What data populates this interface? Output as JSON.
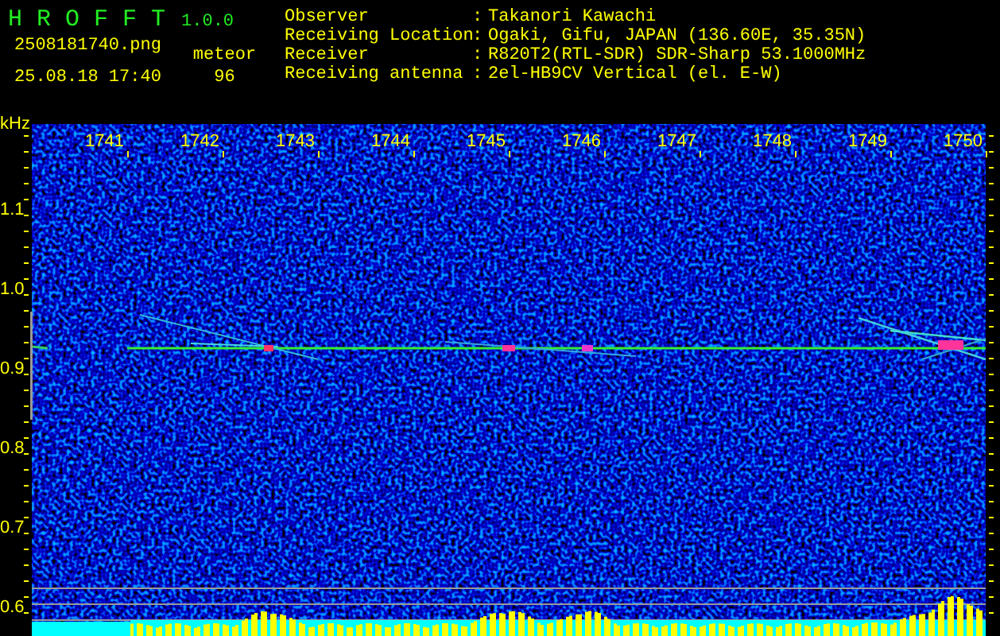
{
  "app": {
    "title": "H R O F F T",
    "version": "1.0.0"
  },
  "file_name": "2508181740.png",
  "timestamp": "25.08.18 17:40",
  "counter": {
    "label": "meteor",
    "value": "96"
  },
  "info": [
    {
      "label": "Observer",
      "separator": ":",
      "value": "Takanori Kawachi"
    },
    {
      "label": "Receiving Location",
      "separator": ":",
      "value": "Ogaki, Gifu, JAPAN (136.60E, 35.35N)"
    },
    {
      "label": "Receiver",
      "separator": ":",
      "value": "R820T2(RTL-SDR) SDR-Sharp 53.1000MHz"
    },
    {
      "label": "Receiving antenna",
      "separator": ":",
      "value": "2el-HB9CV Vertical (el. E-W)"
    }
  ],
  "spectrogram": {
    "y_unit": "kHz",
    "x_labels": [
      "1741",
      "1742",
      "1743",
      "1744",
      "1745",
      "1746",
      "1747",
      "1748",
      "1749",
      "1750"
    ],
    "y_labels": [
      "1.1",
      "1.0",
      "0.9",
      "0.8",
      "0.7",
      "0.6"
    ]
  }
}
